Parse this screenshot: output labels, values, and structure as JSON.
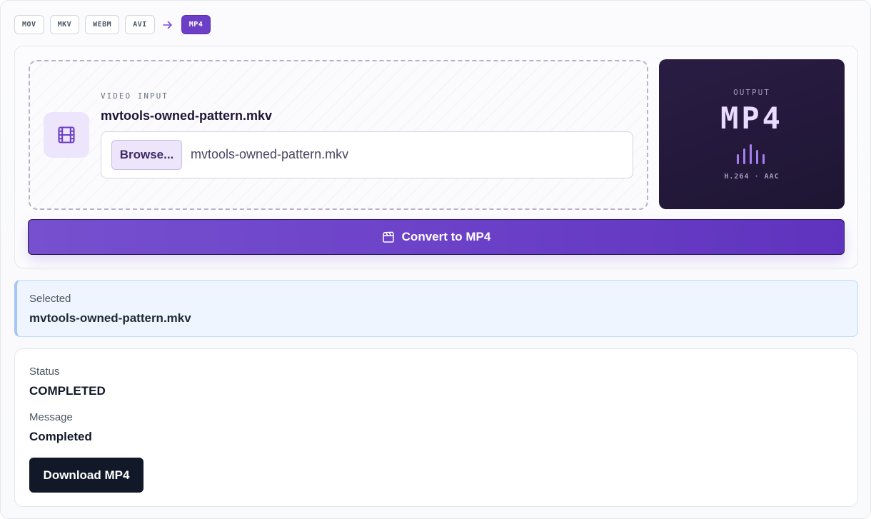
{
  "formats": {
    "inputs": [
      "MOV",
      "MKV",
      "WEBM",
      "AVI"
    ],
    "target": "MP4"
  },
  "converter": {
    "input_label": "VIDEO INPUT",
    "input_filename": "mvtools-owned-pattern.mkv",
    "browse_label": "Browse...",
    "file_field_value": "mvtools-owned-pattern.mkv",
    "output_label": "OUTPUT",
    "output_format": "MP4",
    "output_codec": "H.264 · AAC",
    "convert_label": "Convert to MP4"
  },
  "selected": {
    "label": "Selected",
    "value": "mvtools-owned-pattern.mkv"
  },
  "status": {
    "status_label": "Status",
    "status_value": "COMPLETED",
    "message_label": "Message",
    "message_value": "Completed",
    "download_label": "Download MP4"
  },
  "icons": {
    "film": "film-icon",
    "arrow": "arrow-right-icon",
    "equalizer": "equalizer-icon",
    "clapperboard": "clapperboard-icon"
  },
  "colors": {
    "accent": "#6d3fc6",
    "output_panel": "#241a3b",
    "download_button": "#111827"
  }
}
